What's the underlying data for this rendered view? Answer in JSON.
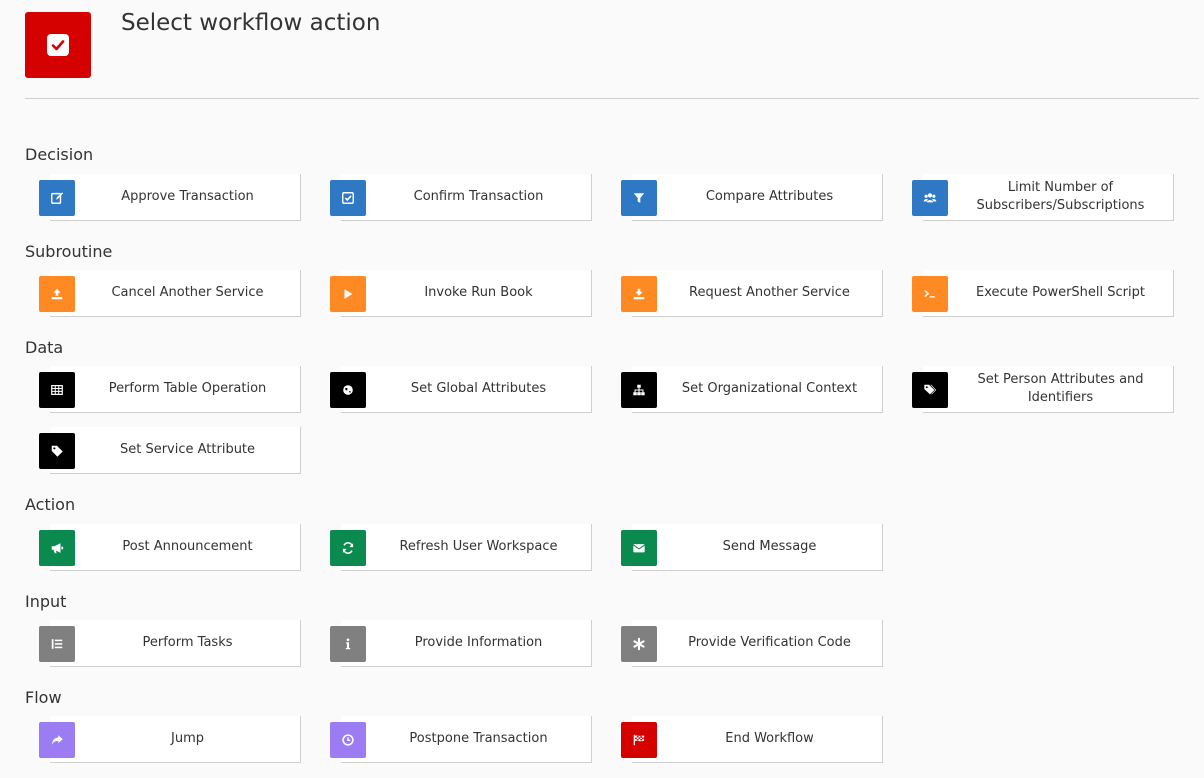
{
  "page": {
    "title": "Select workflow action",
    "header_icon": "checkbox-checked-icon",
    "header_color": "#d50000"
  },
  "colors": {
    "blue": "#2f78c4",
    "orange": "#ff8a24",
    "black": "#000000",
    "green": "#0a8a4e",
    "gray": "#808080",
    "purple": "#9b7cf3",
    "red": "#d50000"
  },
  "sections": [
    {
      "title": "Decision",
      "actions": [
        {
          "label": "Approve Transaction",
          "icon": "edit-icon",
          "color": "#2f78c4"
        },
        {
          "label": "Confirm Transaction",
          "icon": "check-square-icon",
          "color": "#2f78c4"
        },
        {
          "label": "Compare Attributes",
          "icon": "filter-icon",
          "color": "#2f78c4"
        },
        {
          "label": "Limit Number of Subscribers/Subscriptions",
          "icon": "users-icon",
          "color": "#2f78c4"
        }
      ]
    },
    {
      "title": "Subroutine",
      "actions": [
        {
          "label": "Cancel Another Service",
          "icon": "upload-icon",
          "color": "#ff8a24"
        },
        {
          "label": "Invoke Run Book",
          "icon": "play-icon",
          "color": "#ff8a24"
        },
        {
          "label": "Request Another Service",
          "icon": "download-icon",
          "color": "#ff8a24"
        },
        {
          "label": "Execute PowerShell Script",
          "icon": "terminal-icon",
          "color": "#ff8a24"
        }
      ]
    },
    {
      "title": "Data",
      "actions": [
        {
          "label": "Perform Table Operation",
          "icon": "table-icon",
          "color": "#000000"
        },
        {
          "label": "Set Global Attributes",
          "icon": "globe-icon",
          "color": "#000000"
        },
        {
          "label": "Set Organizational Context",
          "icon": "sitemap-icon",
          "color": "#000000"
        },
        {
          "label": "Set Person Attributes and Identifiers",
          "icon": "tags-icon",
          "color": "#000000"
        },
        {
          "label": "Set Service Attribute",
          "icon": "tag-icon",
          "color": "#000000"
        }
      ]
    },
    {
      "title": "Action",
      "actions": [
        {
          "label": "Post Announcement",
          "icon": "bullhorn-icon",
          "color": "#0a8a4e"
        },
        {
          "label": "Refresh User Workspace",
          "icon": "refresh-icon",
          "color": "#0a8a4e"
        },
        {
          "label": "Send Message",
          "icon": "envelope-icon",
          "color": "#0a8a4e"
        }
      ]
    },
    {
      "title": "Input",
      "actions": [
        {
          "label": "Perform Tasks",
          "icon": "list-icon",
          "color": "#808080"
        },
        {
          "label": "Provide Information",
          "icon": "info-icon",
          "color": "#808080"
        },
        {
          "label": "Provide Verification Code",
          "icon": "asterisk-icon",
          "color": "#808080"
        }
      ]
    },
    {
      "title": "Flow",
      "actions": [
        {
          "label": "Jump",
          "icon": "share-arrow-icon",
          "color": "#9b7cf3"
        },
        {
          "label": "Postpone Transaction",
          "icon": "clock-icon",
          "color": "#9b7cf3"
        },
        {
          "label": "End Workflow",
          "icon": "flag-checkered-icon",
          "color": "#d50000"
        }
      ]
    }
  ]
}
